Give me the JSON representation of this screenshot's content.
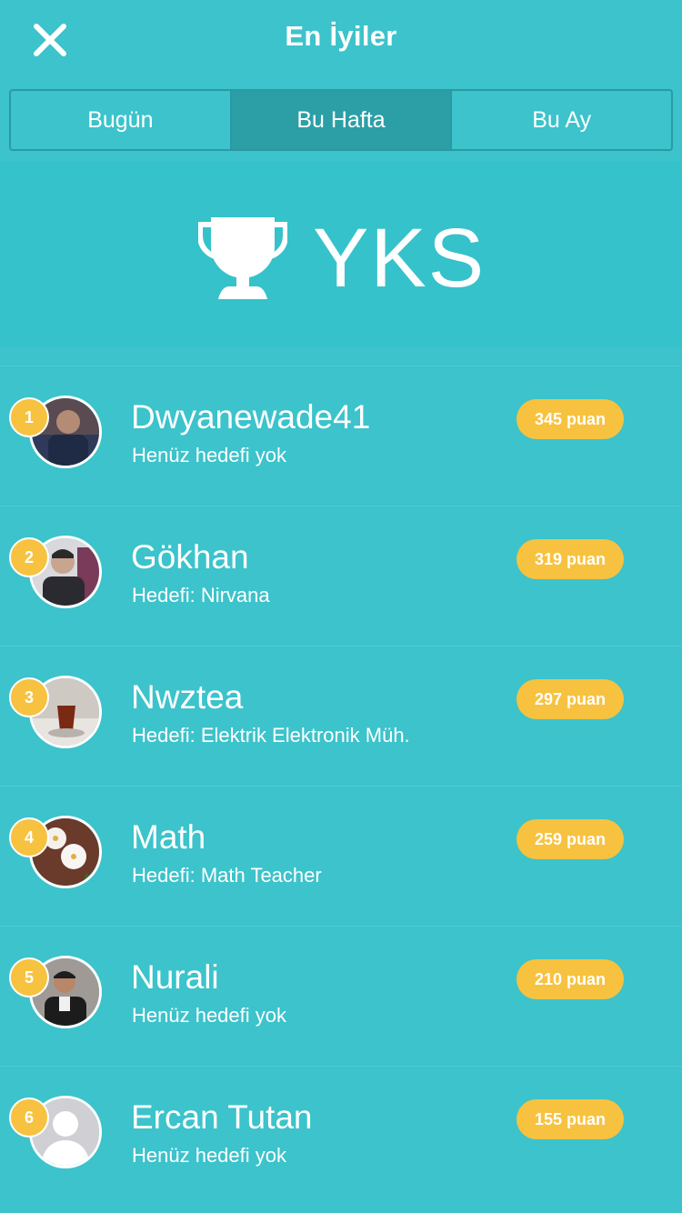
{
  "header": {
    "title": "En İyiler",
    "close_icon": "close-icon"
  },
  "tabs": [
    {
      "label": "Bugün",
      "active": false
    },
    {
      "label": "Bu Hafta",
      "active": true
    },
    {
      "label": "Bu Ay",
      "active": false
    }
  ],
  "banner": {
    "icon": "trophy-icon",
    "text": "YKS"
  },
  "leaderboard": [
    {
      "rank": "1",
      "name": "Dwyanewade41",
      "goal": "Henüz hedefi yok",
      "score": "345 puan",
      "avatar": "photo"
    },
    {
      "rank": "2",
      "name": "Gökhan",
      "goal": "Hedefi: Nirvana",
      "score": "319 puan",
      "avatar": "photo"
    },
    {
      "rank": "3",
      "name": "Nwztea",
      "goal": "Hedefi: Elektrik Elektronik Müh.",
      "score": "297 puan",
      "avatar": "photo"
    },
    {
      "rank": "4",
      "name": "Math",
      "goal": "Hedefi: Math Teacher",
      "score": "259 puan",
      "avatar": "photo"
    },
    {
      "rank": "5",
      "name": "Nurali",
      "goal": "Henüz hedefi yok",
      "score": "210 puan",
      "avatar": "photo"
    },
    {
      "rank": "6",
      "name": "Ercan Tutan",
      "goal": "Henüz hedefi yok",
      "score": "155 puan",
      "avatar": "default-user-icon"
    }
  ],
  "colors": {
    "background": "#3cc3cb",
    "active_tab": "#2c9fa6",
    "badge": "#f7c23f",
    "text": "#ffffff"
  }
}
